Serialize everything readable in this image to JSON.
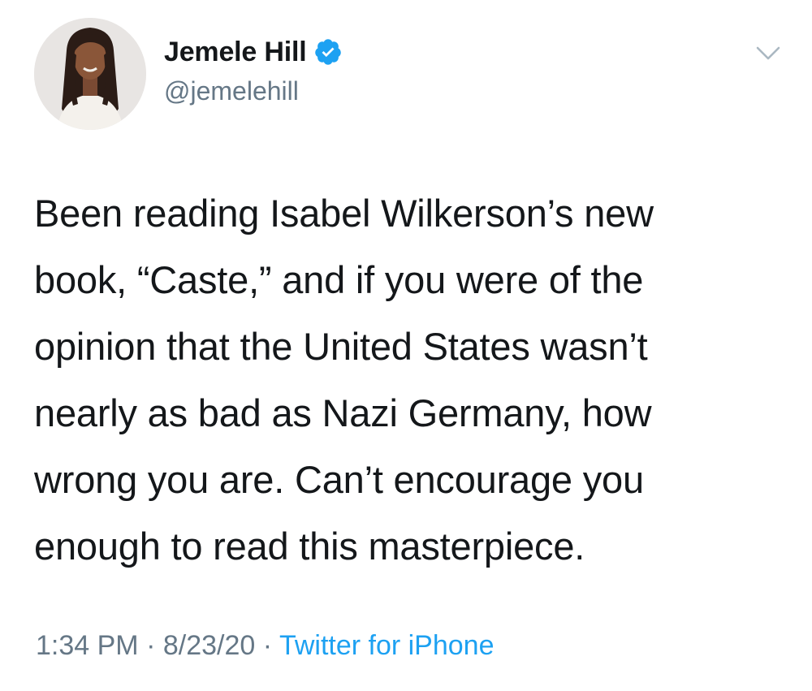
{
  "user": {
    "display_name": "Jemele Hill",
    "handle": "@jemelehill",
    "verified": true,
    "avatar": "profile-photo"
  },
  "tweet": {
    "lines": [
      "Been reading Isabel Wilkerson’s new",
      "book, “Caste,” and if you were of the",
      "opinion that the United States wasn’t",
      "nearly as bad as Nazi Germany, how",
      "wrong you are. Can’t encourage you",
      "enough to read this masterpiece."
    ]
  },
  "meta": {
    "time": "1:34 PM",
    "separator": "·",
    "date": "8/23/20",
    "source": "Twitter for iPhone"
  },
  "icons": {
    "verified": "verified-badge-icon",
    "menu": "chevron-down-icon"
  },
  "colors": {
    "text": "#14171a",
    "secondary": "#657786",
    "link": "#1da1f2",
    "verified": "#1da1f2"
  }
}
